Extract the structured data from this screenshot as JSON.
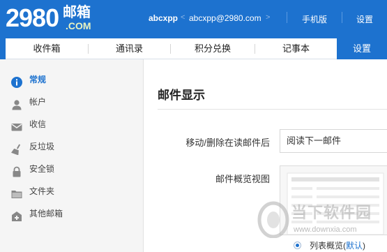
{
  "header": {
    "logo_number": "2980",
    "logo_cn": "邮箱",
    "logo_dotcom": ".COM",
    "username": "abcxpp",
    "separator": "<",
    "email": "abcxpp@2980.com",
    "email_arrow": ">",
    "mobile_label": "手机版",
    "settings_label": "设置"
  },
  "nav": {
    "tabs": [
      {
        "label": "收件箱"
      },
      {
        "label": "通讯录"
      },
      {
        "label": "积分兑换"
      },
      {
        "label": "记事本"
      },
      {
        "label": "设置"
      }
    ],
    "active_tab": "设置"
  },
  "sidebar": {
    "items": [
      {
        "label": "常规",
        "icon": "info-icon",
        "active": true
      },
      {
        "label": "帐户",
        "icon": "user-icon"
      },
      {
        "label": "收信",
        "icon": "envelope-icon"
      },
      {
        "label": "反垃圾",
        "icon": "broom-icon"
      },
      {
        "label": "安全锁",
        "icon": "lock-icon"
      },
      {
        "label": "文件夹",
        "icon": "folder-icon"
      },
      {
        "label": "其他邮箱",
        "icon": "mailbox-plus-icon"
      }
    ]
  },
  "main": {
    "section_title": "邮件显示",
    "move_delete_label": "移动/删除在读邮件后",
    "move_delete_value": "阅读下一邮件",
    "preview_label": "邮件概览视图",
    "radio_list_label": "列表概览",
    "radio_default_open": "(",
    "radio_default_label": "默认",
    "radio_default_close": ")"
  },
  "watermark": {
    "name": "当下软件园",
    "url": "www.downxia.com"
  },
  "colors": {
    "brand_blue": "#1d72cf",
    "sidebar_bg": "#f5f5f5"
  }
}
